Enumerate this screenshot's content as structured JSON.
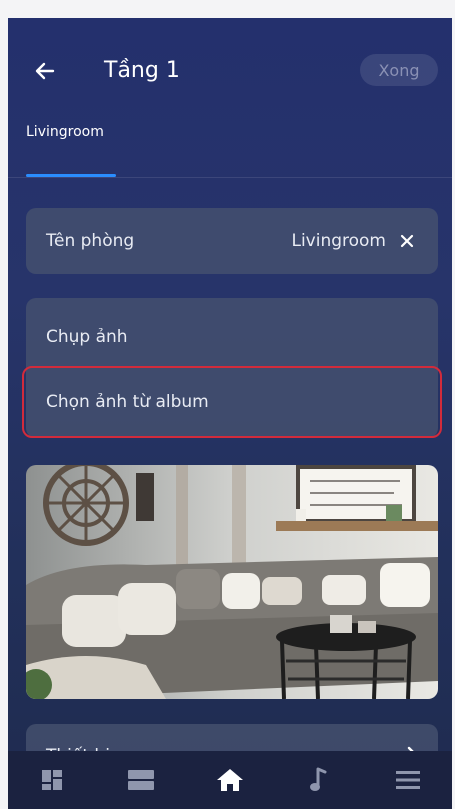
{
  "header": {
    "title": "Tầng 1",
    "done_label": "Xong"
  },
  "tabs": [
    {
      "label": "Livingroom",
      "active": true
    }
  ],
  "room_name": {
    "label": "Tên phòng",
    "value": "Livingroom"
  },
  "photo_options": {
    "take_photo": "Chụp ảnh",
    "choose_album": "Chọn ảnh từ album"
  },
  "device_section": {
    "label": "Thiết bị"
  },
  "colors": {
    "accent": "#2a8dff",
    "highlight": "#d22b3b",
    "background": "#24306d"
  },
  "navbar": {
    "items": [
      "dashboard-icon",
      "list-icon",
      "home-icon",
      "music-icon",
      "menu-icon"
    ],
    "active": "home-icon"
  }
}
